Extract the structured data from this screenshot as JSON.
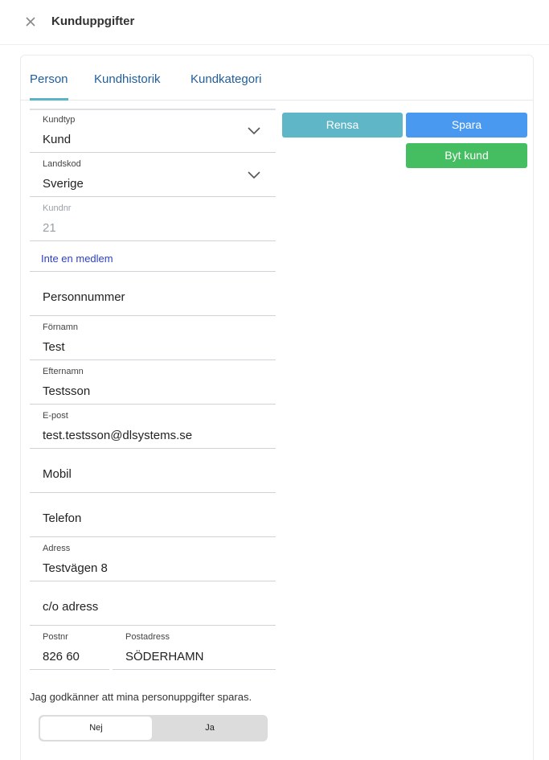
{
  "header": {
    "title": "Kunduppgifter",
    "close_icon": "close-icon"
  },
  "tabs": [
    {
      "label": "Person",
      "active": true
    },
    {
      "label": "Kundhistorik",
      "active": false
    },
    {
      "label": "Kundkategori",
      "active": false
    }
  ],
  "form": {
    "kundtyp": {
      "label": "Kundtyp",
      "value": "Kund"
    },
    "landskod": {
      "label": "Landskod",
      "value": "Sverige"
    },
    "kundnr": {
      "label": "Kundnr",
      "value": "21"
    },
    "member_link": "Inte en medlem",
    "personnummer": {
      "placeholder": "Personnummer"
    },
    "fornamn": {
      "label": "Förnamn",
      "value": "Test"
    },
    "efternamn": {
      "label": "Efternamn",
      "value": "Testsson"
    },
    "epost": {
      "label": "E-post",
      "value": "test.testsson@dlsystems.se"
    },
    "mobil": {
      "placeholder": "Mobil"
    },
    "telefon": {
      "placeholder": "Telefon"
    },
    "adress": {
      "label": "Adress",
      "value": "Testvägen 8"
    },
    "co_adress": {
      "placeholder": "c/o adress"
    },
    "postnr": {
      "label": "Postnr",
      "value": "826 60"
    },
    "postadress": {
      "label": "Postadress",
      "value": "SÖDERHAMN"
    }
  },
  "actions": {
    "rensa": "Rensa",
    "spara": "Spara",
    "byt_kund": "Byt kund"
  },
  "consent": {
    "text": "Jag godkänner att mina personuppgifter sparas.",
    "options": [
      "Nej",
      "Ja"
    ],
    "selected": "Nej"
  },
  "colors": {
    "accent_tab": "#1f5e9e",
    "tab_underline": "#5ab4c5",
    "rensa": "#5eb6c6",
    "spara": "#4a99f0",
    "byt_kund": "#45be62",
    "link": "#2b3ec9"
  }
}
